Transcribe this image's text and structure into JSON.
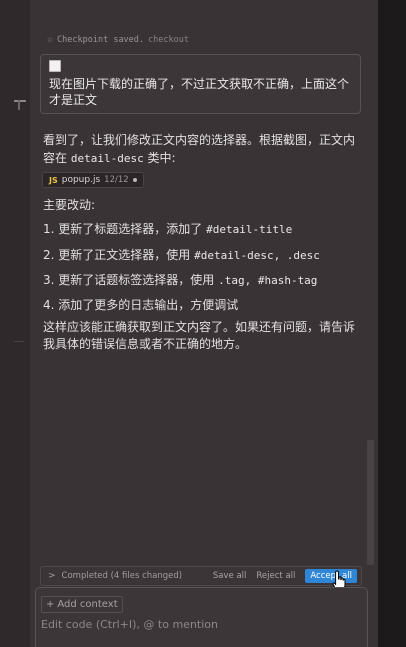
{
  "checkpoint": {
    "icon": "pin-icon",
    "text": "Checkpoint saved.",
    "link": "checkout"
  },
  "user_message": {
    "text": "现在图片下载的正确了，不过正文获取不正确，上面这个才是正文"
  },
  "response": {
    "intro_part1": "看到了，让我们修改正文内容的选择器。根据截图，正文内容在",
    "intro_code": "detail-desc",
    "intro_part2": "类中:",
    "file_chip": {
      "icon": "JS",
      "name": "popup.js",
      "meta": "12/12"
    },
    "changes_heading": "主要改动:",
    "items": [
      {
        "text": "1. 更新了标题选择器，添加了",
        "code": "#detail-title"
      },
      {
        "text": "2. 更新了正文选择器，使用",
        "code": "#detail-desc, .desc"
      },
      {
        "text": "3. 更新了话题标签选择器，使用",
        "code": ".tag, #hash-tag"
      },
      {
        "text": "4. 添加了更多的日志输出，方便调试",
        "code": ""
      }
    ],
    "closing": "这样应该能正确获取到正文内容了。如果还有问题，请告诉我具体的错误信息或者不正确的地方。"
  },
  "bottom_bar": {
    "status": "Completed (4 files changed)",
    "save_all": "Save all",
    "reject_all": "Reject all",
    "accept_all": "Accept all",
    "accent": "#2f86d6"
  },
  "input": {
    "add_context": "Add context",
    "placeholder": "Edit code (Ctrl+I), @ to mention"
  }
}
